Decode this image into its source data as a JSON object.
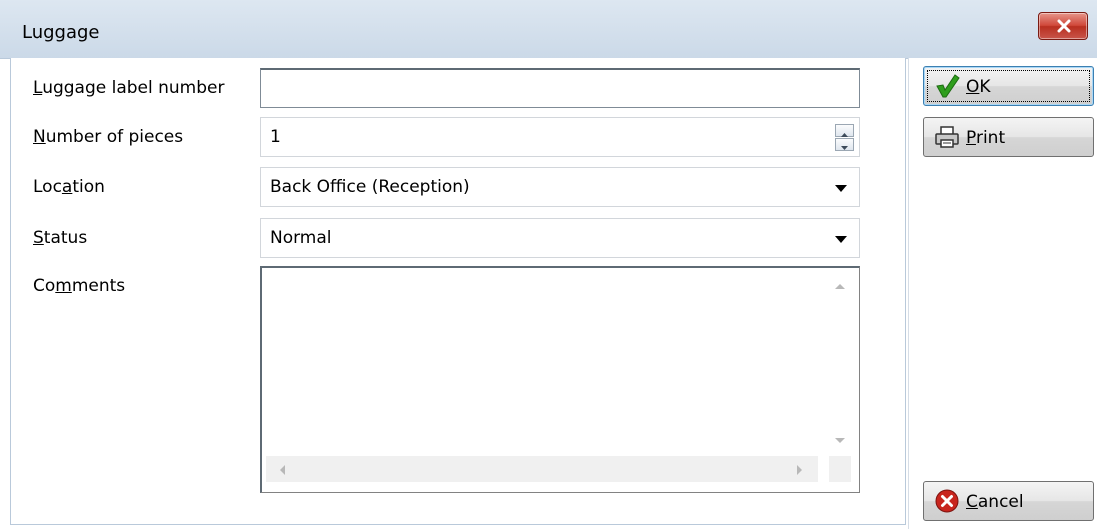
{
  "window": {
    "title": "Luggage"
  },
  "form": {
    "luggage_label_number": {
      "label_pre": "",
      "label_ul": "L",
      "label_post": "uggage label number",
      "value": ""
    },
    "number_of_pieces": {
      "label_pre": "",
      "label_ul": "N",
      "label_post": "umber of pieces",
      "value": "1"
    },
    "location": {
      "label_pre": "Loc",
      "label_ul": "a",
      "label_post": "tion",
      "value": "Back Office (Reception)"
    },
    "status": {
      "label_pre": "",
      "label_ul": "S",
      "label_post": "tatus",
      "value": "Normal"
    },
    "comments": {
      "label_pre": "Co",
      "label_ul": "m",
      "label_post": "ments",
      "value": ""
    }
  },
  "buttons": {
    "ok": {
      "ul": "O",
      "rest": "K"
    },
    "print": {
      "ul": "P",
      "rest": "rint"
    },
    "cancel": {
      "ul": "C",
      "rest": "ancel"
    }
  },
  "icons": {
    "ok": "checkmark-icon",
    "print": "printer-icon",
    "cancel": "cancel-icon",
    "close": "close-icon"
  },
  "colors": {
    "titlebar": "#cbd9e8",
    "close_button": "#c9463a",
    "ok_check": "#2f9e1d",
    "cancel_circle": "#c8251e"
  }
}
